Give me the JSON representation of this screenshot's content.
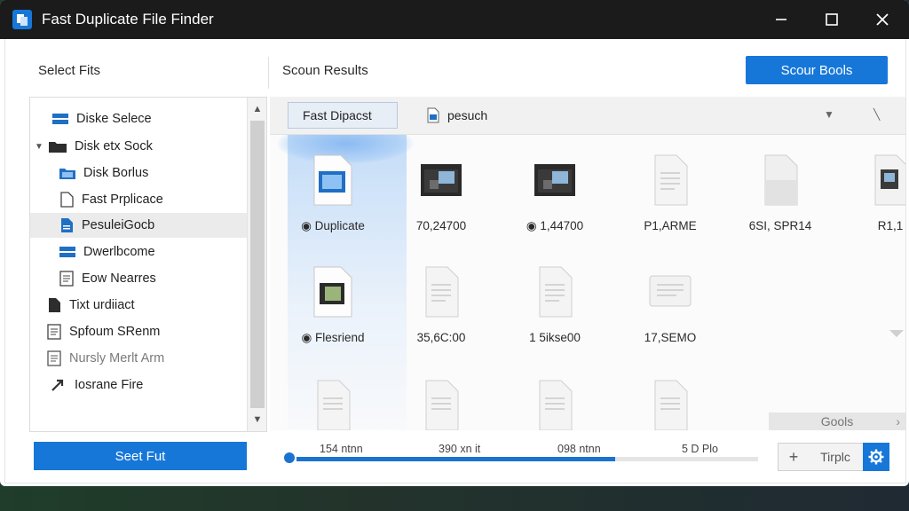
{
  "window": {
    "title": "Fast Duplicate File Finder"
  },
  "header": {
    "left_title": "Select Fits",
    "right_title": "Scoun Results",
    "scan_button": "Scour Bools"
  },
  "sidebar": {
    "items": [
      {
        "label": "Diske Selece",
        "icon": "drive-icon"
      },
      {
        "label": "Disk etx Sock",
        "icon": "folder-icon",
        "expanded": true
      },
      {
        "label": "Disk Borlus",
        "icon": "folder-open-icon"
      },
      {
        "label": "Fast Prplicace",
        "icon": "file-icon"
      },
      {
        "label": "PesuleiGocb",
        "icon": "file-blue-icon",
        "selected": true
      },
      {
        "label": "Dwerlbcome",
        "icon": "drive-icon"
      },
      {
        "label": "Eow Nearres",
        "icon": "document-icon"
      },
      {
        "label": "Tixt urdiiact",
        "icon": "document-icon"
      },
      {
        "label": "Spfoum SRenm",
        "icon": "document-icon"
      },
      {
        "label": "Nursly Merlt Arm",
        "icon": "document-icon",
        "dim": true
      },
      {
        "label": "Iosrane Fire",
        "icon": "arrow-icon"
      }
    ],
    "status_button": "Seet Fut"
  },
  "results": {
    "tabs": [
      {
        "label": "Fast Dipacst",
        "active": true
      },
      {
        "label": "pesuch",
        "active": false
      }
    ],
    "items": [
      {
        "caption": "Duplicate",
        "thumb": "image-file-icon",
        "badge": true
      },
      {
        "caption": "70,24700",
        "thumb": "folder-image-icon"
      },
      {
        "caption": "1,44700",
        "thumb": "folder-image-icon",
        "badge": true
      },
      {
        "caption": "P1,ARME",
        "thumb": "document-icon"
      },
      {
        "caption": "6SI, SPR14",
        "thumb": "document-folded-icon"
      },
      {
        "caption": "R1,1",
        "thumb": "folder-image-icon"
      },
      {
        "caption": "Flesriend",
        "thumb": "image-file-icon",
        "badge": true
      },
      {
        "caption": "35,6C:00",
        "thumb": "document-icon"
      },
      {
        "caption": "1 5ikse00",
        "thumb": "document-icon"
      },
      {
        "caption": "17,SEMO",
        "thumb": "document-icon"
      },
      {
        "caption": "",
        "thumb": "document-icon"
      },
      {
        "caption": "",
        "thumb": "document-icon"
      },
      {
        "caption": "",
        "thumb": "document-icon"
      },
      {
        "caption": "",
        "thumb": "document-icon"
      }
    ],
    "tools_label": "Gools"
  },
  "progress": {
    "labels": [
      "154 ntnn",
      "390 xn it",
      "098 ntnn",
      "5 D Plo"
    ],
    "fill_fraction": 0.69
  },
  "bottom_bar": {
    "add_symbol": "+",
    "template_label": "Tirplc"
  },
  "colors": {
    "accent": "#1677d9",
    "titlebar": "#1b1b1b"
  }
}
